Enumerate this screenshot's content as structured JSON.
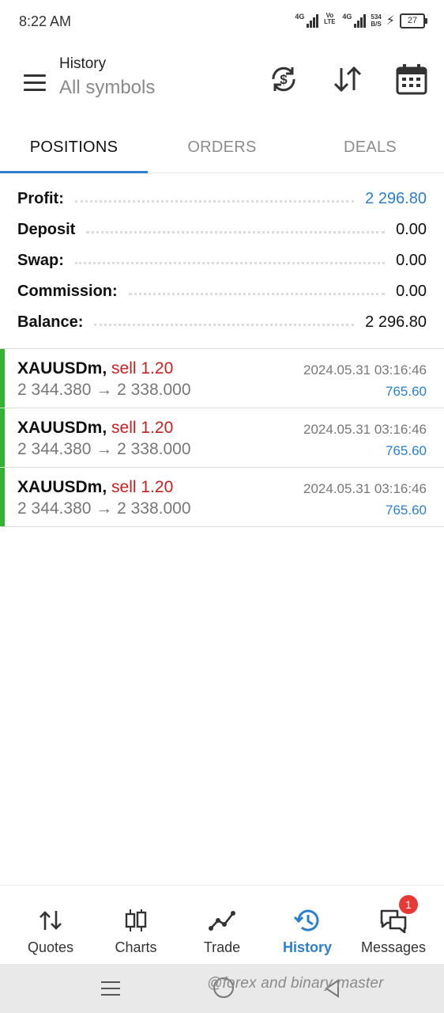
{
  "status_bar": {
    "time": "8:22 AM",
    "sim1_label": "4G",
    "volte_label": "Vo LTE",
    "sim2_label": "4G",
    "speed_value": "534",
    "speed_unit": "B/S",
    "battery": "27"
  },
  "app_bar": {
    "title": "History",
    "subtitle": "All symbols",
    "icons": [
      "menu-icon",
      "currency-exchange-icon",
      "sort-icon",
      "calendar-icon"
    ]
  },
  "tabs": [
    {
      "label": "POSITIONS",
      "active": true
    },
    {
      "label": "ORDERS",
      "active": false
    },
    {
      "label": "DEALS",
      "active": false
    }
  ],
  "summary": {
    "profit_label": "Profit:",
    "profit_value": "2 296.80",
    "deposit_label": "Deposit",
    "deposit_value": "0.00",
    "swap_label": "Swap:",
    "swap_value": "0.00",
    "commission_label": "Commission:",
    "commission_value": "0.00",
    "balance_label": "Balance:",
    "balance_value": "2 296.80"
  },
  "deals": [
    {
      "symbol": "XAUUSDm,",
      "side": "sell 1.20",
      "prices": "2 344.380 → 2 338.000",
      "time": "2024.05.31 03:16:46",
      "profit": "765.60"
    },
    {
      "symbol": "XAUUSDm,",
      "side": "sell 1.20",
      "prices": "2 344.380 → 2 338.000",
      "time": "2024.05.31 03:16:46",
      "profit": "765.60"
    },
    {
      "symbol": "XAUUSDm,",
      "side": "sell 1.20",
      "prices": "2 344.380 → 2 338.000",
      "time": "2024.05.31 03:16:46",
      "profit": "765.60"
    }
  ],
  "bottom_nav": [
    {
      "label": "Quotes",
      "icon": "quotes-icon",
      "active": false
    },
    {
      "label": "Charts",
      "icon": "candlestick-icon",
      "active": false
    },
    {
      "label": "Trade",
      "icon": "trade-line-icon",
      "active": false
    },
    {
      "label": "History",
      "icon": "history-icon",
      "active": true
    },
    {
      "label": "Messages",
      "icon": "chat-icon",
      "active": false,
      "badge": "1"
    }
  ],
  "watermark": "@forex and binary master",
  "colors": {
    "accent_blue": "#2b7fcb",
    "sell_red": "#c62020",
    "position_green": "#34b233",
    "badge_red": "#e53935"
  }
}
